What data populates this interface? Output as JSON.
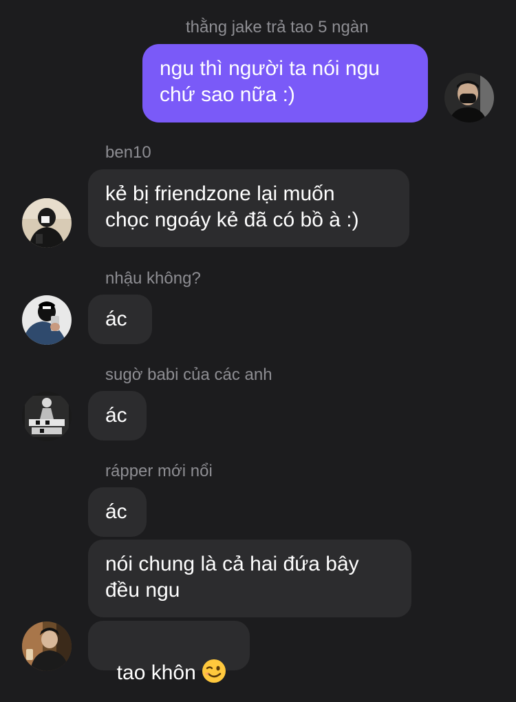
{
  "messages": [
    {
      "sender": "thằng jake trả tao 5 ngàn",
      "text": "ngu thì người ta nói ngu\nchứ sao nữa :)",
      "mine": true
    },
    {
      "sender": "ben10",
      "text": "kẻ bị friendzone lại muốn\nchọc ngoáy kẻ đã có bồ à :)"
    },
    {
      "sender": "nhậu không?",
      "text": "ác"
    },
    {
      "sender": "sugờ babi của các anh",
      "text": "ác"
    },
    {
      "sender": "rápper mới nổi",
      "text": "ác"
    },
    {
      "text": "nói chung là cả hai đứa bây\nđều ngu"
    },
    {
      "text": "tao khôn",
      "emoji": "winking-face-emoji"
    }
  ],
  "avatars": [
    {
      "name": "my-avatar-icon"
    },
    {
      "name": "ben10-avatar-icon"
    },
    {
      "name": "nhau-khong-avatar-icon"
    },
    {
      "name": "sugo-babi-avatar-icon"
    },
    {
      "name": "rapper-avatar-icon"
    }
  ],
  "colors": {
    "background": "#1c1c1e",
    "incoming_bubble": "#2c2c2e",
    "outgoing_bubble": "#7a5af8",
    "sender_label": "#8e8e93"
  }
}
